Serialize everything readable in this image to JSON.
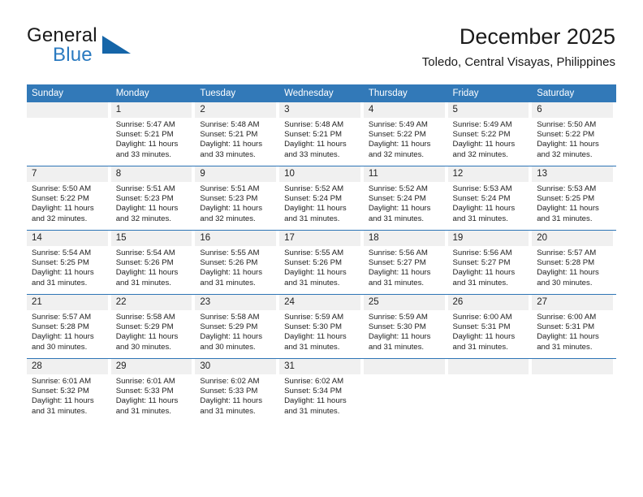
{
  "logo": {
    "text_top": "General",
    "text_bottom": "Blue",
    "triangle_icon": "logo-triangle-icon",
    "brand_color": "#2a7ac0"
  },
  "header": {
    "title": "December 2025",
    "subtitle": "Toledo, Central Visayas, Philippines"
  },
  "theme": {
    "header_blue": "#3279b8",
    "rule_blue": "#2e75b6",
    "daynum_band": "#f0f0f0",
    "text": "#222222"
  },
  "weekday_headers": [
    "Sunday",
    "Monday",
    "Tuesday",
    "Wednesday",
    "Thursday",
    "Friday",
    "Saturday"
  ],
  "weeks": [
    [
      {
        "day": "",
        "sunrise": "",
        "sunset": "",
        "daylight_1": "",
        "daylight_2": ""
      },
      {
        "day": "1",
        "sunrise": "Sunrise: 5:47 AM",
        "sunset": "Sunset: 5:21 PM",
        "daylight_1": "Daylight: 11 hours",
        "daylight_2": "and 33 minutes."
      },
      {
        "day": "2",
        "sunrise": "Sunrise: 5:48 AM",
        "sunset": "Sunset: 5:21 PM",
        "daylight_1": "Daylight: 11 hours",
        "daylight_2": "and 33 minutes."
      },
      {
        "day": "3",
        "sunrise": "Sunrise: 5:48 AM",
        "sunset": "Sunset: 5:21 PM",
        "daylight_1": "Daylight: 11 hours",
        "daylight_2": "and 33 minutes."
      },
      {
        "day": "4",
        "sunrise": "Sunrise: 5:49 AM",
        "sunset": "Sunset: 5:22 PM",
        "daylight_1": "Daylight: 11 hours",
        "daylight_2": "and 32 minutes."
      },
      {
        "day": "5",
        "sunrise": "Sunrise: 5:49 AM",
        "sunset": "Sunset: 5:22 PM",
        "daylight_1": "Daylight: 11 hours",
        "daylight_2": "and 32 minutes."
      },
      {
        "day": "6",
        "sunrise": "Sunrise: 5:50 AM",
        "sunset": "Sunset: 5:22 PM",
        "daylight_1": "Daylight: 11 hours",
        "daylight_2": "and 32 minutes."
      }
    ],
    [
      {
        "day": "7",
        "sunrise": "Sunrise: 5:50 AM",
        "sunset": "Sunset: 5:22 PM",
        "daylight_1": "Daylight: 11 hours",
        "daylight_2": "and 32 minutes."
      },
      {
        "day": "8",
        "sunrise": "Sunrise: 5:51 AM",
        "sunset": "Sunset: 5:23 PM",
        "daylight_1": "Daylight: 11 hours",
        "daylight_2": "and 32 minutes."
      },
      {
        "day": "9",
        "sunrise": "Sunrise: 5:51 AM",
        "sunset": "Sunset: 5:23 PM",
        "daylight_1": "Daylight: 11 hours",
        "daylight_2": "and 32 minutes."
      },
      {
        "day": "10",
        "sunrise": "Sunrise: 5:52 AM",
        "sunset": "Sunset: 5:24 PM",
        "daylight_1": "Daylight: 11 hours",
        "daylight_2": "and 31 minutes."
      },
      {
        "day": "11",
        "sunrise": "Sunrise: 5:52 AM",
        "sunset": "Sunset: 5:24 PM",
        "daylight_1": "Daylight: 11 hours",
        "daylight_2": "and 31 minutes."
      },
      {
        "day": "12",
        "sunrise": "Sunrise: 5:53 AM",
        "sunset": "Sunset: 5:24 PM",
        "daylight_1": "Daylight: 11 hours",
        "daylight_2": "and 31 minutes."
      },
      {
        "day": "13",
        "sunrise": "Sunrise: 5:53 AM",
        "sunset": "Sunset: 5:25 PM",
        "daylight_1": "Daylight: 11 hours",
        "daylight_2": "and 31 minutes."
      }
    ],
    [
      {
        "day": "14",
        "sunrise": "Sunrise: 5:54 AM",
        "sunset": "Sunset: 5:25 PM",
        "daylight_1": "Daylight: 11 hours",
        "daylight_2": "and 31 minutes."
      },
      {
        "day": "15",
        "sunrise": "Sunrise: 5:54 AM",
        "sunset": "Sunset: 5:26 PM",
        "daylight_1": "Daylight: 11 hours",
        "daylight_2": "and 31 minutes."
      },
      {
        "day": "16",
        "sunrise": "Sunrise: 5:55 AM",
        "sunset": "Sunset: 5:26 PM",
        "daylight_1": "Daylight: 11 hours",
        "daylight_2": "and 31 minutes."
      },
      {
        "day": "17",
        "sunrise": "Sunrise: 5:55 AM",
        "sunset": "Sunset: 5:26 PM",
        "daylight_1": "Daylight: 11 hours",
        "daylight_2": "and 31 minutes."
      },
      {
        "day": "18",
        "sunrise": "Sunrise: 5:56 AM",
        "sunset": "Sunset: 5:27 PM",
        "daylight_1": "Daylight: 11 hours",
        "daylight_2": "and 31 minutes."
      },
      {
        "day": "19",
        "sunrise": "Sunrise: 5:56 AM",
        "sunset": "Sunset: 5:27 PM",
        "daylight_1": "Daylight: 11 hours",
        "daylight_2": "and 31 minutes."
      },
      {
        "day": "20",
        "sunrise": "Sunrise: 5:57 AM",
        "sunset": "Sunset: 5:28 PM",
        "daylight_1": "Daylight: 11 hours",
        "daylight_2": "and 30 minutes."
      }
    ],
    [
      {
        "day": "21",
        "sunrise": "Sunrise: 5:57 AM",
        "sunset": "Sunset: 5:28 PM",
        "daylight_1": "Daylight: 11 hours",
        "daylight_2": "and 30 minutes."
      },
      {
        "day": "22",
        "sunrise": "Sunrise: 5:58 AM",
        "sunset": "Sunset: 5:29 PM",
        "daylight_1": "Daylight: 11 hours",
        "daylight_2": "and 30 minutes."
      },
      {
        "day": "23",
        "sunrise": "Sunrise: 5:58 AM",
        "sunset": "Sunset: 5:29 PM",
        "daylight_1": "Daylight: 11 hours",
        "daylight_2": "and 30 minutes."
      },
      {
        "day": "24",
        "sunrise": "Sunrise: 5:59 AM",
        "sunset": "Sunset: 5:30 PM",
        "daylight_1": "Daylight: 11 hours",
        "daylight_2": "and 31 minutes."
      },
      {
        "day": "25",
        "sunrise": "Sunrise: 5:59 AM",
        "sunset": "Sunset: 5:30 PM",
        "daylight_1": "Daylight: 11 hours",
        "daylight_2": "and 31 minutes."
      },
      {
        "day": "26",
        "sunrise": "Sunrise: 6:00 AM",
        "sunset": "Sunset: 5:31 PM",
        "daylight_1": "Daylight: 11 hours",
        "daylight_2": "and 31 minutes."
      },
      {
        "day": "27",
        "sunrise": "Sunrise: 6:00 AM",
        "sunset": "Sunset: 5:31 PM",
        "daylight_1": "Daylight: 11 hours",
        "daylight_2": "and 31 minutes."
      }
    ],
    [
      {
        "day": "28",
        "sunrise": "Sunrise: 6:01 AM",
        "sunset": "Sunset: 5:32 PM",
        "daylight_1": "Daylight: 11 hours",
        "daylight_2": "and 31 minutes."
      },
      {
        "day": "29",
        "sunrise": "Sunrise: 6:01 AM",
        "sunset": "Sunset: 5:33 PM",
        "daylight_1": "Daylight: 11 hours",
        "daylight_2": "and 31 minutes."
      },
      {
        "day": "30",
        "sunrise": "Sunrise: 6:02 AM",
        "sunset": "Sunset: 5:33 PM",
        "daylight_1": "Daylight: 11 hours",
        "daylight_2": "and 31 minutes."
      },
      {
        "day": "31",
        "sunrise": "Sunrise: 6:02 AM",
        "sunset": "Sunset: 5:34 PM",
        "daylight_1": "Daylight: 11 hours",
        "daylight_2": "and 31 minutes."
      },
      {
        "day": "",
        "sunrise": "",
        "sunset": "",
        "daylight_1": "",
        "daylight_2": ""
      },
      {
        "day": "",
        "sunrise": "",
        "sunset": "",
        "daylight_1": "",
        "daylight_2": ""
      },
      {
        "day": "",
        "sunrise": "",
        "sunset": "",
        "daylight_1": "",
        "daylight_2": ""
      }
    ]
  ]
}
